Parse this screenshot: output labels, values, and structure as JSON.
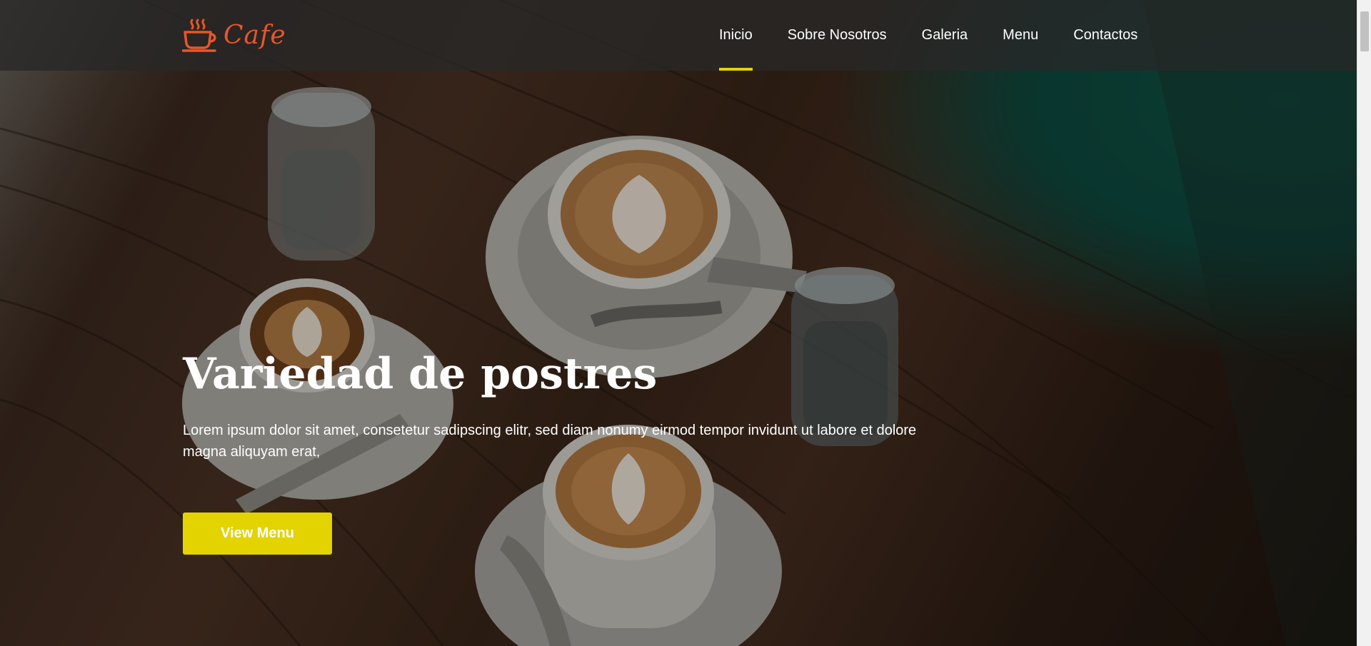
{
  "brand": {
    "name": "Cafe",
    "icon": "coffee-cup-icon",
    "color": "#e8562a"
  },
  "nav": {
    "items": [
      {
        "label": "Inicio",
        "active": true
      },
      {
        "label": "Sobre Nosotros",
        "active": false
      },
      {
        "label": "Galeria",
        "active": false
      },
      {
        "label": "Menu",
        "active": false
      },
      {
        "label": "Contactos",
        "active": false
      }
    ],
    "active_indicator_color": "#e3d300"
  },
  "hero": {
    "title": "Variedad de postres",
    "text": "Lorem ipsum dolor sit amet, consetetur sadipscing elitr, sed diam nonumy eirmod tempor invidunt ut labore et dolore magna aliquyam erat,",
    "button_label": "View Menu",
    "button_color": "#e3d300",
    "background": "coffee-cups-on-wooden-table-photo"
  }
}
